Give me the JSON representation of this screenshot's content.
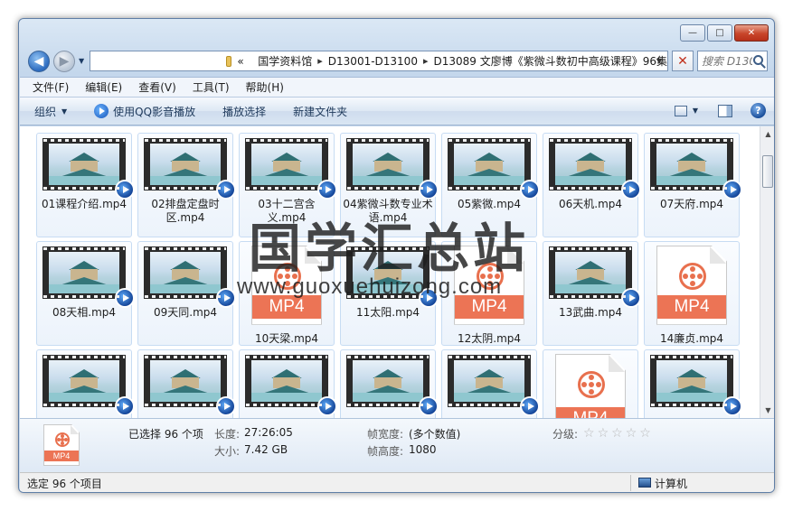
{
  "window": {
    "controls": {
      "minimize": "—",
      "maximize": "□",
      "close": "✕"
    }
  },
  "address": {
    "progress_percent": 63,
    "overflow": "«",
    "crumbs": [
      "国学资料馆",
      "D13001-D13100",
      "D13089 文廖博《紫微斗数初中高级课程》96集"
    ],
    "search_placeholder": "搜索 D130..."
  },
  "menu": [
    "文件(F)",
    "编辑(E)",
    "查看(V)",
    "工具(T)",
    "帮助(H)"
  ],
  "toolbar": {
    "organize": "组织",
    "play_qq": "使用QQ影音播放",
    "play_selection": "播放选择",
    "new_folder": "新建文件夹"
  },
  "files": [
    {
      "name": "01课程介绍.mp4",
      "thumb": "video"
    },
    {
      "name": "02排盘定盘时区.mp4",
      "thumb": "video"
    },
    {
      "name": "03十二宫含义.mp4",
      "thumb": "video"
    },
    {
      "name": "04紫微斗数专业术语.mp4",
      "thumb": "video"
    },
    {
      "name": "05紫微.mp4",
      "thumb": "video"
    },
    {
      "name": "06天机.mp4",
      "thumb": "video"
    },
    {
      "name": "07天府.mp4",
      "thumb": "video"
    },
    {
      "name": "08天相.mp4",
      "thumb": "video"
    },
    {
      "name": "09天同.mp4",
      "thumb": "video"
    },
    {
      "name": "10天梁.mp4",
      "thumb": "mp4-icon"
    },
    {
      "name": "11太阳.mp4",
      "thumb": "video"
    },
    {
      "name": "12太阴.mp4",
      "thumb": "mp4-icon"
    },
    {
      "name": "13武曲.mp4",
      "thumb": "video"
    },
    {
      "name": "14廉贞.mp4",
      "thumb": "mp4-icon"
    },
    {
      "name": "",
      "thumb": "video"
    },
    {
      "name": "",
      "thumb": "video"
    },
    {
      "name": "",
      "thumb": "video"
    },
    {
      "name": "",
      "thumb": "video"
    },
    {
      "name": "",
      "thumb": "video"
    },
    {
      "name": "",
      "thumb": "mp4-icon"
    },
    {
      "name": "",
      "thumb": "video"
    }
  ],
  "mp4_label": "MP4",
  "watermark": {
    "cn": "国学汇总站",
    "url": "www.guoxuehuizong.com"
  },
  "details": {
    "selected": "已选择 96 个项",
    "length_label": "长度:",
    "length": "27:26:05",
    "size_label": "大小:",
    "size": "7.42 GB",
    "frame_width_label": "帧宽度:",
    "frame_width": "(多个数值)",
    "frame_height_label": "帧高度:",
    "frame_height": "1080",
    "rating_label": "分级:",
    "rating_stars": 0
  },
  "status": {
    "left": "选定 96 个项目",
    "right": "计算机"
  }
}
